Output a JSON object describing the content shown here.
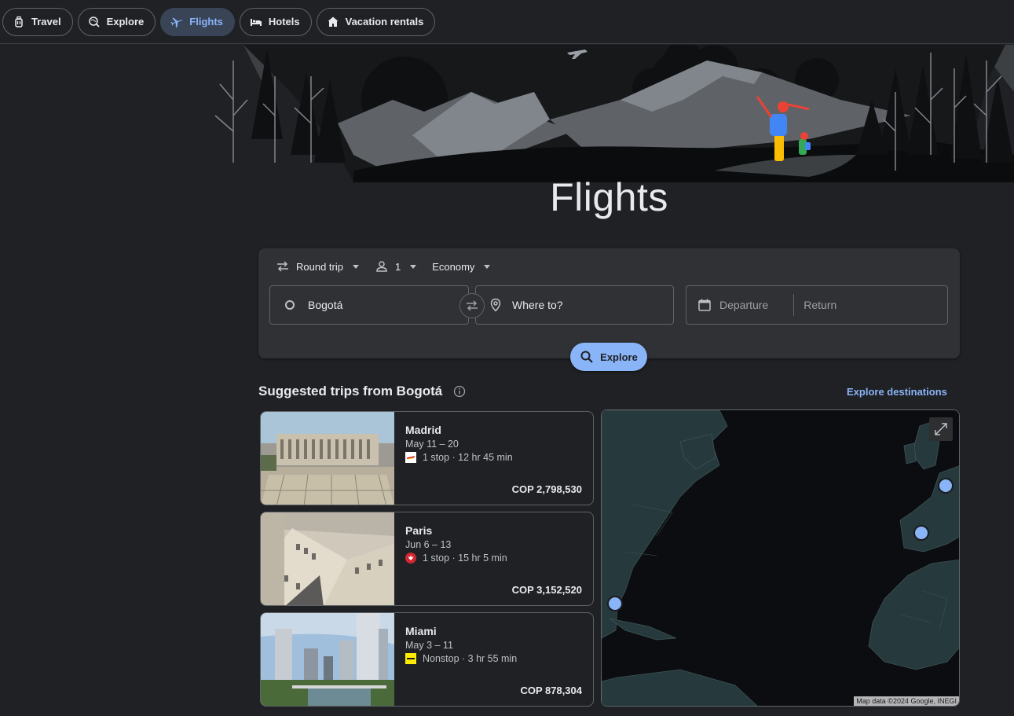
{
  "nav": {
    "chips": [
      {
        "label": "Travel",
        "icon": "travel-bag-icon"
      },
      {
        "label": "Explore",
        "icon": "explore-globe-icon"
      },
      {
        "label": "Flights",
        "icon": "plane-icon",
        "active": true
      },
      {
        "label": "Hotels",
        "icon": "bed-icon"
      },
      {
        "label": "Vacation rentals",
        "icon": "house-icon"
      }
    ]
  },
  "hero": {
    "title": "Flights"
  },
  "search": {
    "trip_type": "Round trip",
    "passengers": "1",
    "cabin_class": "Economy",
    "origin": "Bogotá",
    "destination_placeholder": "Where to?",
    "departure_placeholder": "Departure",
    "return_placeholder": "Return",
    "explore_label": "Explore"
  },
  "suggested": {
    "title": "Suggested trips from Bogotá",
    "explore_link": "Explore destinations",
    "trips": [
      {
        "city": "Madrid",
        "dates": "May 11 – 20",
        "flight": "1 stop · 12 hr 45 min",
        "price": "COP 2,798,530",
        "airline_icon": "iberia-logo-icon"
      },
      {
        "city": "Paris",
        "dates": "Jun 6 – 13",
        "flight": "1 stop · 15 hr 5 min",
        "price": "COP 3,152,520",
        "airline_icon": "air-canada-logo-icon"
      },
      {
        "city": "Miami",
        "dates": "May 3 – 11",
        "flight": "Nonstop · 3 hr 55 min",
        "price": "COP 878,304",
        "airline_icon": "spirit-logo-icon"
      }
    ]
  },
  "map": {
    "credit": "Map data ©2024 Google, INEGI"
  },
  "colors": {
    "accent": "#8ab4f8",
    "background": "#202124",
    "card": "#303134"
  }
}
